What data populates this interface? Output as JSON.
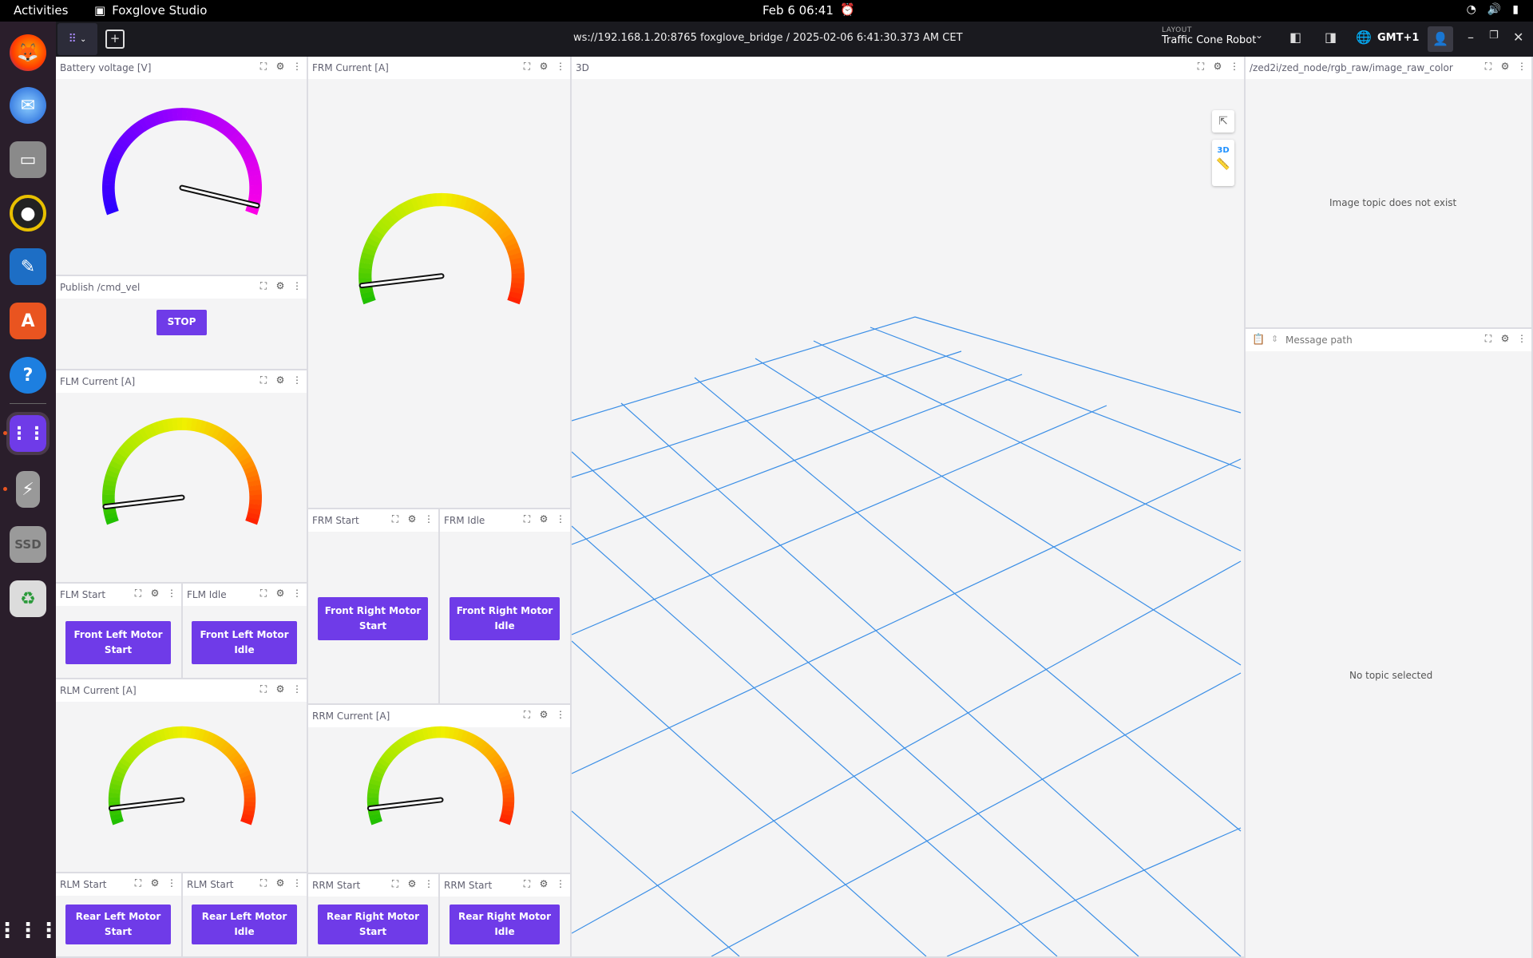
{
  "os": {
    "activities": "Activities",
    "app_name": "Foxglove Studio",
    "clock": "Feb 6  06:41"
  },
  "dock": {
    "items": [
      "firefox-icon",
      "thunderbird-icon",
      "files-icon",
      "rhythmbox-icon",
      "libreoffice-writer-icon",
      "app-center-icon",
      "help-icon",
      "foxglove-icon",
      "usb-drive-icon",
      "ssd-drive-icon",
      "trash-icon"
    ],
    "ssd_label": "SSD"
  },
  "appbar": {
    "connection": "ws://192.168.1.20:8765 foxglove_bridge / 2025-02-06 6:41:30.373 AM CET",
    "layout_caption": "LAYOUT",
    "layout_name": "Traffic Cone Robot",
    "timezone": "GMT+1"
  },
  "panels": {
    "battery": {
      "title": "Battery voltage [V]",
      "needle": 0.97,
      "colors": [
        "#2b00ff",
        "#a100ff",
        "#ff00e6"
      ]
    },
    "cmd_vel": {
      "title": "Publish /cmd_vel",
      "button": "STOP"
    },
    "flm_current": {
      "title": "FLM Current [A]",
      "needle": 0.06
    },
    "frm_current": {
      "title": "FRM Current [A]",
      "needle": 0.06
    },
    "rlm_current": {
      "title": "RLM Current [A]",
      "needle": 0.06
    },
    "rrm_current": {
      "title": "RRM Current [A]",
      "needle": 0.06
    },
    "flm_start": {
      "title": "FLM Start",
      "button_l1": "Front Left Motor",
      "button_l2": "Start"
    },
    "flm_idle": {
      "title": "FLM Idle",
      "button_l1": "Front Left Motor",
      "button_l2": "Idle"
    },
    "frm_start": {
      "title": "FRM Start",
      "button_l1": "Front Right Motor",
      "button_l2": "Start"
    },
    "frm_idle": {
      "title": "FRM Idle",
      "button_l1": "Front Right Motor",
      "button_l2": "Idle"
    },
    "rlm_start": {
      "title": "RLM Start",
      "button_l1": "Rear Left Motor",
      "button_l2": "Start"
    },
    "rlm_idle": {
      "title": "RLM Start",
      "button_l1": "Rear Left Motor",
      "button_l2": "Idle"
    },
    "rrm_start": {
      "title": "RRM Start",
      "button_l1": "Rear Right Motor",
      "button_l2": "Start"
    },
    "rrm_idle": {
      "title": "RRM Start",
      "button_l1": "Rear Right Motor",
      "button_l2": "Idle"
    },
    "three_d": {
      "title": "3D",
      "mode_label": "3D",
      "grid_color": "#3a8ee6"
    },
    "image": {
      "title": "/zed2i/zed_node/rgb_raw/image_raw_color",
      "message": "Image topic does not exist"
    },
    "raw": {
      "placeholder": "Message path",
      "message": "No topic selected"
    }
  },
  "colors": {
    "accent": "#6f3be8",
    "rainbow": [
      "#22c000",
      "#a8e800",
      "#f0f000",
      "#ffa000",
      "#ff1a00"
    ]
  }
}
